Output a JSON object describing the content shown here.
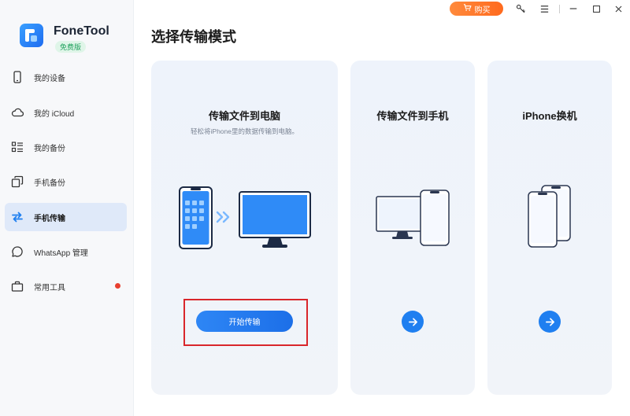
{
  "app": {
    "name": "FoneTool",
    "edition_badge": "免费版"
  },
  "titlebar": {
    "buy_label": "购买"
  },
  "page_title": "选择传输模式",
  "sidebar": {
    "items": [
      {
        "label": "我的设备",
        "icon": "phone-icon"
      },
      {
        "label": "我的 iCloud",
        "icon": "cloud-icon"
      },
      {
        "label": "我的备份",
        "icon": "list-icon"
      },
      {
        "label": "手机备份",
        "icon": "copy-icon"
      },
      {
        "label": "手机传输",
        "icon": "transfer-icon",
        "active": true
      },
      {
        "label": "WhatsApp 管理",
        "icon": "chat-icon"
      },
      {
        "label": "常用工具",
        "icon": "toolbox-icon",
        "has_red_dot": true
      }
    ]
  },
  "cards": [
    {
      "title": "传输文件到电脑",
      "subtitle": "轻松将iPhone里的数据传输到电脑。",
      "button_label": "开始传输",
      "highlighted": true
    },
    {
      "title": "传输文件到手机"
    },
    {
      "title": "iPhone换机"
    }
  ],
  "colors": {
    "accent": "#1f7ff0",
    "active_nav_bg": "#dfe9f9",
    "buy_button": "#ff7a2a",
    "highlight_border": "#d9262b"
  }
}
